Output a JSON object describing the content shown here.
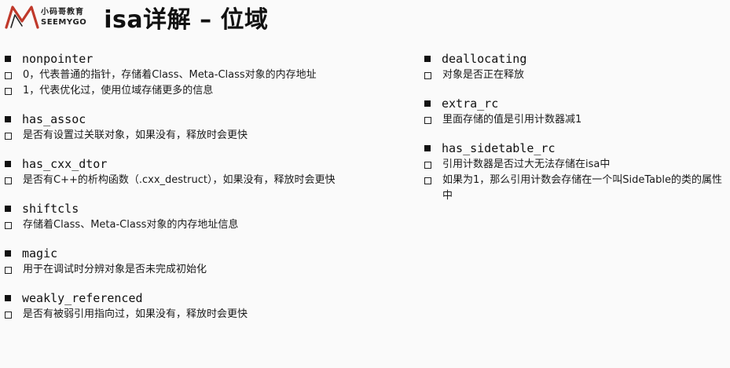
{
  "header": {
    "logo_cn": "小码哥教育",
    "logo_en": "SEEMYGO",
    "title": "isa详解 – 位域"
  },
  "left": [
    {
      "term": "nonpointer",
      "descs": [
        "0，代表普通的指针，存储着Class、Meta-Class对象的内存地址",
        "1，代表优化过，使用位域存储更多的信息"
      ]
    },
    {
      "term": "has_assoc",
      "descs": [
        "是否有设置过关联对象，如果没有，释放时会更快"
      ]
    },
    {
      "term": "has_cxx_dtor",
      "descs": [
        "是否有C++的析构函数（.cxx_destruct），如果没有，释放时会更快"
      ]
    },
    {
      "term": "shiftcls",
      "descs": [
        "存储着Class、Meta-Class对象的内存地址信息"
      ]
    },
    {
      "term": "magic",
      "descs": [
        "用于在调试时分辨对象是否未完成初始化"
      ]
    },
    {
      "term": "weakly_referenced",
      "descs": [
        "是否有被弱引用指向过，如果没有，释放时会更快"
      ]
    }
  ],
  "right": [
    {
      "term": "deallocating",
      "descs": [
        "对象是否正在释放"
      ]
    },
    {
      "term": "extra_rc",
      "descs": [
        "里面存储的值是引用计数器减1"
      ]
    },
    {
      "term": "has_sidetable_rc",
      "descs": [
        "引用计数器是否过大无法存储在isa中",
        "如果为1，那么引用计数会存储在一个叫SideTable的类的属性中"
      ]
    }
  ]
}
